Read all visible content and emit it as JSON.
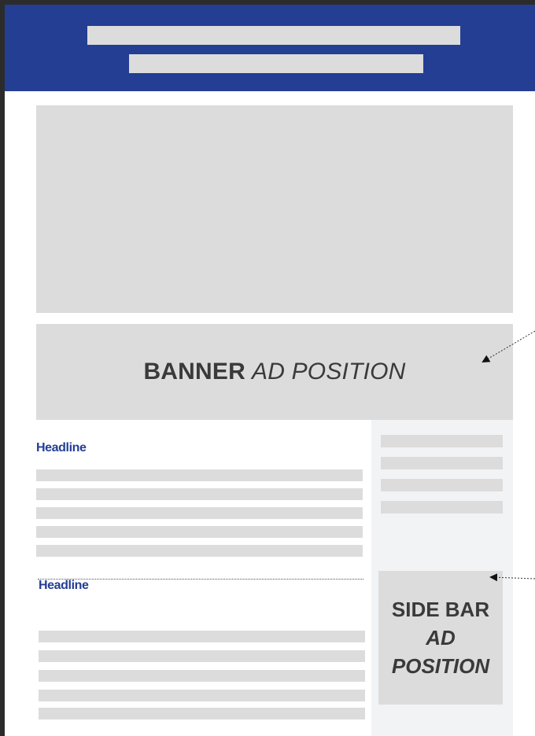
{
  "colors": {
    "accent": "#233e93",
    "placeholder": "#dcdcdd",
    "sidebar_bg": "#f2f3f5",
    "text_dark": "#3a3a3a"
  },
  "banner": {
    "bold_text": "BANNER",
    "italic_text": "AD POSITION"
  },
  "articles": [
    {
      "headline": "Headline"
    },
    {
      "headline": "Headline"
    }
  ],
  "sidebar_ad": {
    "line1": "SIDE BAR",
    "line2": "AD",
    "line3": "POSITION"
  }
}
